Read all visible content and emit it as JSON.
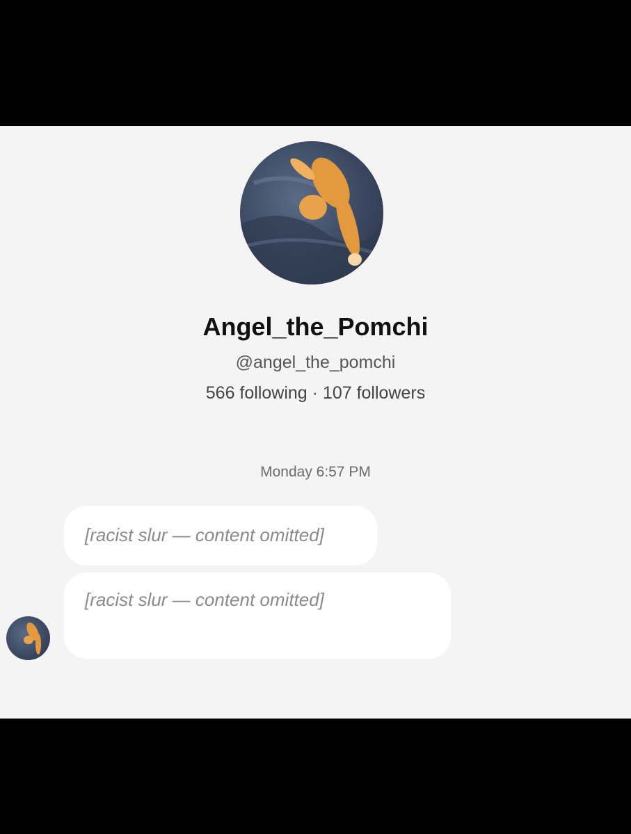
{
  "profile": {
    "display_name": "Angel_the_Pomchi",
    "handle": "@angel_the_pomchi",
    "stats": "566 following · 107 followers",
    "avatar_icon": "cat-photo-avatar-icon"
  },
  "thread": {
    "timestamp": "Monday 6:57 PM",
    "messages": [
      {
        "text": "[racist slur — content omitted]"
      },
      {
        "text": "[racist slur — content omitted]"
      }
    ]
  },
  "colors": {
    "background": "#f4f4f4",
    "bubble": "#ffffff",
    "letterbox": "#000000"
  }
}
